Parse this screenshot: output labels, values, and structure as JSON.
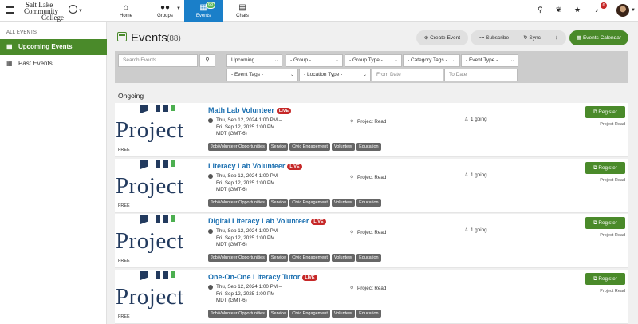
{
  "logo": {
    "line1": "Salt Lake",
    "line2": "Community",
    "line3": "College"
  },
  "nav": {
    "home": "Home",
    "groups": "Groups",
    "events": "Events",
    "events_badge": "68",
    "chats": "Chats"
  },
  "topbar": {
    "notifications_badge": "6"
  },
  "sidebar": {
    "heading": "ALL EVENTS",
    "items": [
      {
        "label": "Upcoming Events",
        "active": true
      },
      {
        "label": "Past Events",
        "active": false
      }
    ]
  },
  "header": {
    "title": "Events",
    "count": "(88)",
    "create_label": "Create Event",
    "subscribe_label": "Subscribe",
    "sync_label": "Sync",
    "calendar_label": "Events Calendar"
  },
  "filters": {
    "search_placeholder": "Search Events",
    "upcoming": "Upcoming",
    "group": "- Group -",
    "group_type": "- Group Type -",
    "category_tags": "- Category Tags -",
    "event_type": "- Event Type -",
    "event_tags": "- Event Tags -",
    "location_type": "- Location Type -",
    "from_date_placeholder": "From Date",
    "to_date_placeholder": "To Date"
  },
  "section_label": "Ongoing",
  "thumb": {
    "word": "Project",
    "price": "FREE"
  },
  "events": [
    {
      "title": "Math Lab Volunteer",
      "live": "LIVE",
      "when_line1": "Thu, Sep 12, 2024 1:00 PM –",
      "when_line2": "Fri, Sep 12, 2025 1:00 PM",
      "when_line3": "MDT (GMT-6)",
      "location": "Project Read",
      "going": "1 going",
      "register": "Register",
      "host": "Project Read",
      "tags": [
        "Job/Volunteer Opportunities",
        "Service",
        "Civic Engagement",
        "Volunteer",
        "Education"
      ]
    },
    {
      "title": "Literacy Lab Volunteer",
      "live": "LIVE",
      "when_line1": "Thu, Sep 12, 2024 1:00 PM –",
      "when_line2": "Fri, Sep 12, 2025 1:00 PM",
      "when_line3": "MDT (GMT-6)",
      "location": "Project Read",
      "going": "1 going",
      "register": "Register",
      "host": "Project Read",
      "tags": [
        "Job/Volunteer Opportunities",
        "Service",
        "Civic Engagement",
        "Volunteer",
        "Education"
      ]
    },
    {
      "title": "Digital Literacy Lab Volunteer",
      "live": "LIVE",
      "when_line1": "Thu, Sep 12, 2024 1:00 PM –",
      "when_line2": "Fri, Sep 12, 2025 1:00 PM",
      "when_line3": "MDT (GMT-6)",
      "location": "Project Read",
      "going": "1 going",
      "register": "Register",
      "host": "Project Read",
      "tags": [
        "Job/Volunteer Opportunities",
        "Service",
        "Civic Engagement",
        "Volunteer",
        "Education"
      ]
    },
    {
      "title": "One-On-One Literacy Tutor",
      "live": "LIVE",
      "when_line1": "Thu, Sep 12, 2024 1:00 PM –",
      "when_line2": "Fri, Sep 12, 2025 1:00 PM",
      "when_line3": "MDT (GMT-6)",
      "location": "Project Read",
      "going": "",
      "register": "Register",
      "host": "Project Read",
      "tags": [
        "Job/Volunteer Opportunities",
        "Service",
        "Civic Engagement",
        "Volunteer",
        "Education"
      ]
    }
  ]
}
